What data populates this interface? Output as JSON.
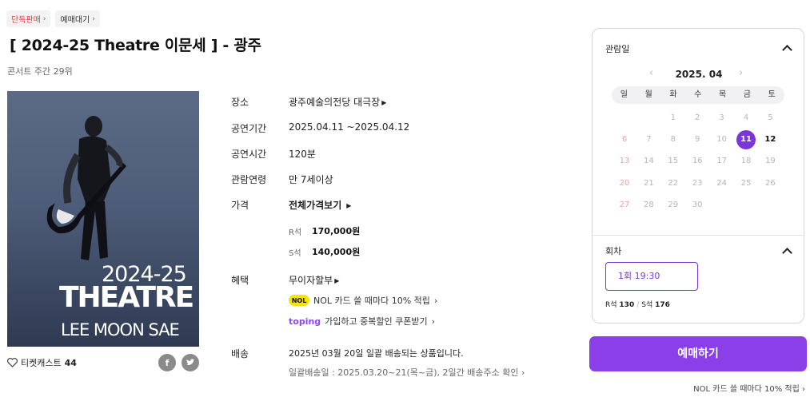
{
  "badges": [
    "단독판매",
    "예매대기"
  ],
  "title": "[ 2024-25 Theatre 이문세 ]  - 광주",
  "ranking": "콘서트 주간 29위",
  "poster": {
    "year": "2024-25",
    "title": "THEATRE",
    "artist": "LEE MOON SAE"
  },
  "cast": {
    "label": "티켓캐스트",
    "count": "44"
  },
  "share_icons": [
    "facebook-icon",
    "twitter-icon"
  ],
  "info": {
    "venue_label": "장소",
    "venue": "광주예술의전당 대극장",
    "period_label": "공연기간",
    "period": "2025.04.11 ~2025.04.12",
    "runtime_label": "공연시간",
    "runtime": "120분",
    "age_label": "관람연령",
    "age": "만 7세이상",
    "price_label": "가격",
    "price_link": "전체가격보기",
    "prices": [
      {
        "seat": "R석",
        "amount": "170,000원"
      },
      {
        "seat": "S석",
        "amount": "140,000원"
      }
    ],
    "benefit_label": "혜택",
    "benefit_main": "무이자할부",
    "nol_logo": "NOL",
    "benefit_nol": "NOL 카드 쓸 때마다 10% 적립",
    "toping_logo": "toping",
    "benefit_toping": "가입하고 중복할인 쿠폰받기",
    "delivery_label": "배송",
    "delivery": "2025년 03월 20일 일괄 배송되는 상품입니다.",
    "delivery_note": "일괄배송일 : 2025.03.20~21(목~금), 2일간 배송주소 확인"
  },
  "calendar": {
    "header": "관람일",
    "month": "2025. 04",
    "weekdays": [
      "일",
      "월",
      "화",
      "수",
      "목",
      "금",
      "토"
    ],
    "weeks": [
      [
        "",
        "",
        "1",
        "2",
        "3",
        "4",
        "5"
      ],
      [
        "6",
        "7",
        "8",
        "9",
        "10",
        "11",
        "12"
      ],
      [
        "13",
        "14",
        "15",
        "16",
        "17",
        "18",
        "19"
      ],
      [
        "20",
        "21",
        "22",
        "23",
        "24",
        "25",
        "26"
      ],
      [
        "27",
        "28",
        "29",
        "30",
        "",
        "",
        ""
      ]
    ],
    "selected_day": "11",
    "available_days": [
      "12"
    ]
  },
  "session": {
    "header": "회차",
    "selected": "1회  19:30",
    "seats": [
      {
        "grade": "R석",
        "count": "130"
      },
      {
        "grade": "S석",
        "count": "176"
      }
    ]
  },
  "book_button": "예매하기",
  "bottom_note": "NOL 카드 쓸 때마다 10% 적립 ›",
  "colors": {
    "accent": "#7b36d9",
    "button": "#8b3fe8",
    "sunday": "#f3a0a0",
    "badge_red": "#e23b3b"
  }
}
